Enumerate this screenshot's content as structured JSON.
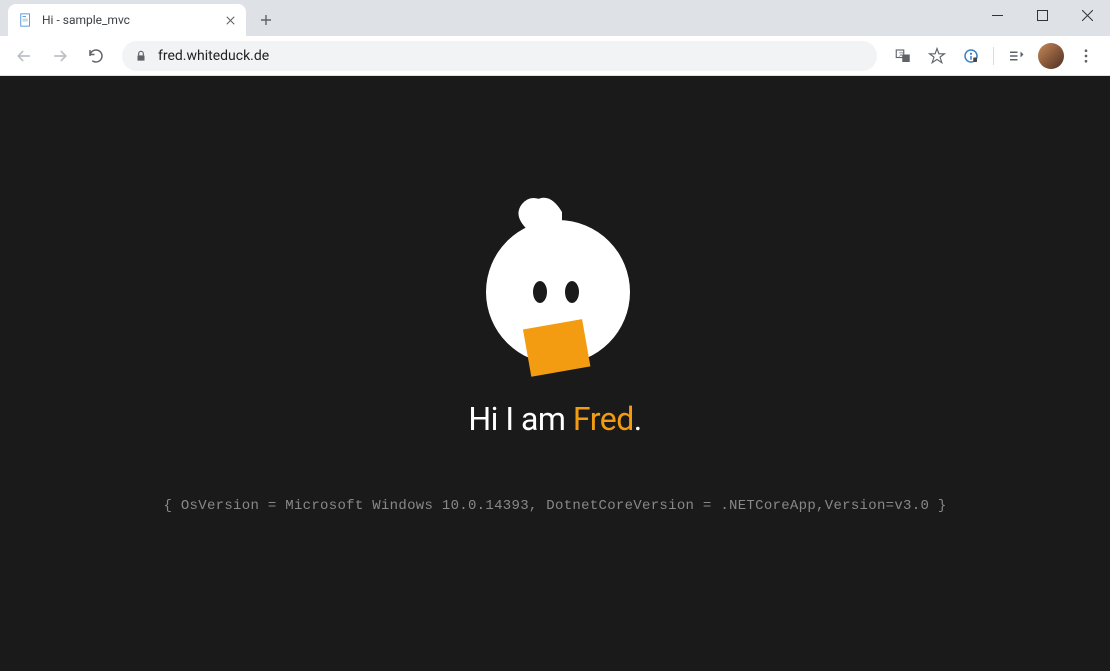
{
  "browser": {
    "tab": {
      "title": "Hi - sample_mvc"
    },
    "url": "fred.whiteduck.de"
  },
  "page": {
    "heading_prefix": "Hi I am ",
    "heading_highlight": "Fred",
    "heading_suffix": ".",
    "system_info": "{ OsVersion = Microsoft Windows 10.0.14393, DotnetCoreVersion = .NETCoreApp,Version=v3.0 }"
  }
}
